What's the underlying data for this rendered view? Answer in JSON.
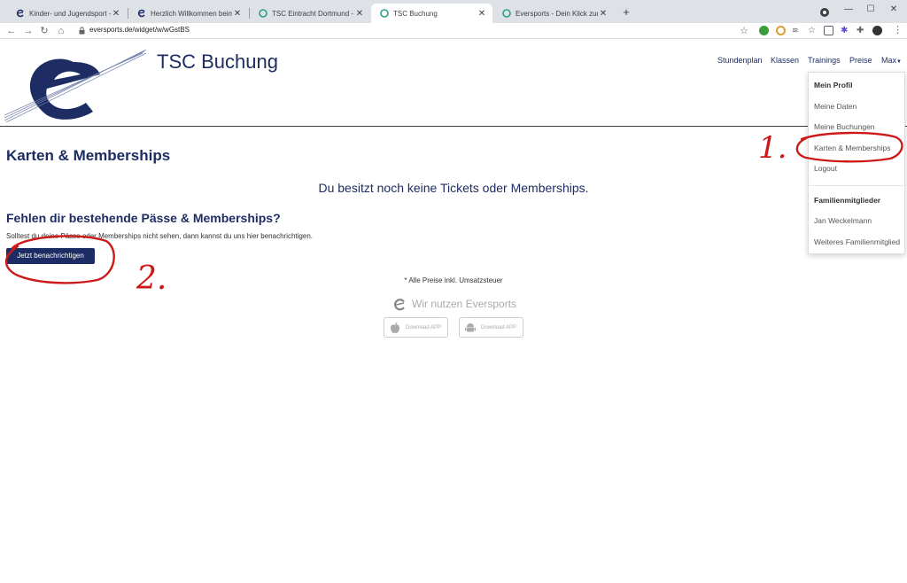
{
  "browser": {
    "tabs": [
      {
        "title": "Kinder- und Jugendsport - TSC E"
      },
      {
        "title": "Herzlich Willkommen beim TSC E"
      },
      {
        "title": "TSC Eintracht Dortmund - Dashb"
      },
      {
        "title": "TSC Buchung",
        "active": true
      },
      {
        "title": "Eversports - Dein Klick zum Sport"
      }
    ],
    "url": "eversports.de/widget/w/wGstBS"
  },
  "header": {
    "brand": "TSC Buchung",
    "nav": [
      "Stundenplan",
      "Klassen",
      "Trainings",
      "Preise",
      "Max"
    ]
  },
  "dropdown": {
    "profile_header": "Mein Profil",
    "profile_items": [
      "Meine Daten",
      "Meine Buchungen",
      "Karten & Memberships",
      "Logout"
    ],
    "family_header": "Familienmitglieder",
    "family_items": [
      "Jan Weckelmann",
      "Weiteres Familienmitglied"
    ]
  },
  "main": {
    "title": "Karten & Memberships",
    "empty_message": "Du besitzt noch keine Tickets oder Memberships.",
    "missing_heading": "Fehlen dir bestehende Pässe & Memberships?",
    "missing_text": "Solltest du deine Pässe oder Memberships nicht sehen, dann kannst du uns hier benachrichtigen.",
    "notify_button": "Jetzt benachrichtigen",
    "tax_note": "* Alle Preise inkl. Umsatzsteuer",
    "powered_by": "Wir nutzen Eversports",
    "app_buttons": [
      "Download APP",
      "Download APP"
    ]
  },
  "annotations": {
    "step1": "1.",
    "step2": "2."
  },
  "colors": {
    "brand": "#1d2d63",
    "annotation": "#cc1a1a",
    "dropdown_text": "#555555"
  }
}
